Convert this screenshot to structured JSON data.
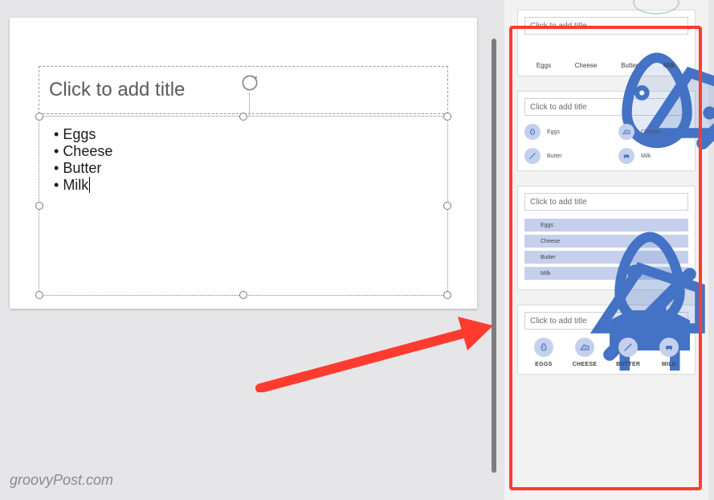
{
  "slide": {
    "title_placeholder": "Click to add title",
    "bullets": [
      "Eggs",
      "Cheese",
      "Butter",
      "Milk"
    ]
  },
  "design_ideas": {
    "title_placeholder": "Click to add title",
    "items": [
      {
        "label": "Eggs",
        "upper": "EGGS",
        "icon": "egg-icon"
      },
      {
        "label": "Cheese",
        "upper": "CHEESE",
        "icon": "cheese-icon"
      },
      {
        "label": "Butter",
        "upper": "BUTTER",
        "icon": "butter-icon"
      },
      {
        "label": "Milk",
        "upper": "MILK",
        "icon": "cow-icon"
      }
    ]
  },
  "watermark": "groovyPost.com"
}
